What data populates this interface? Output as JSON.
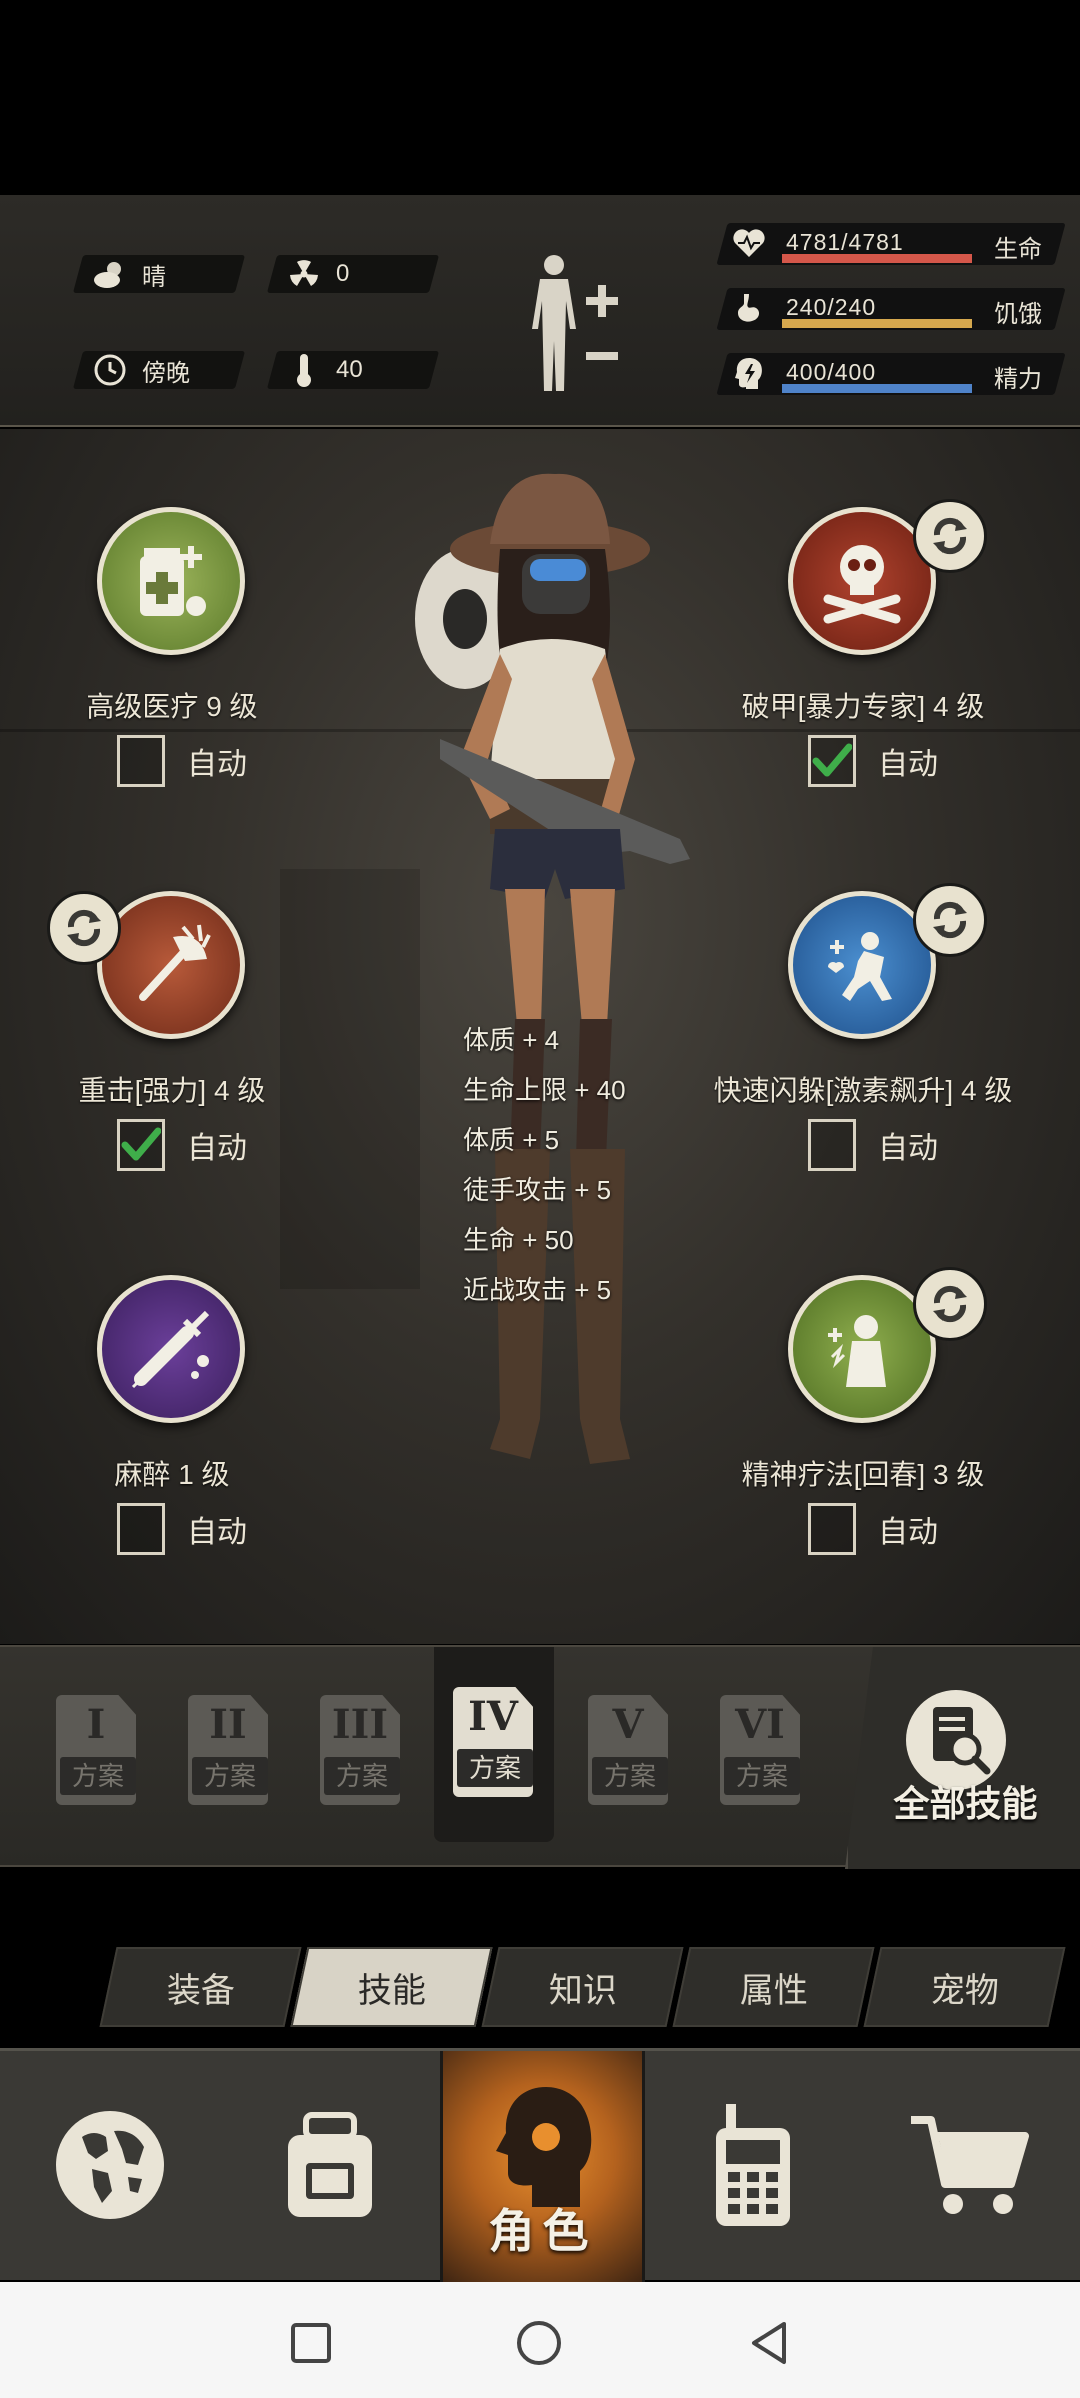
{
  "environment": {
    "weather": "晴",
    "radiation": "0",
    "time_of_day": "傍晚",
    "temperature": "40"
  },
  "vitals": [
    {
      "name": "health",
      "value": "4781/4781",
      "label": "生命",
      "fraction": 1.0,
      "color": "#d5574a"
    },
    {
      "name": "hunger",
      "value": "240/240",
      "label": "饥饿",
      "fraction": 1.0,
      "color": "#d6a84e"
    },
    {
      "name": "energy",
      "value": "400/400",
      "label": "精力",
      "fraction": 1.0,
      "color": "#4f83c9"
    }
  ],
  "skills": [
    {
      "name": "高级医疗 9 级",
      "auto_label": "自动",
      "auto_checked": false,
      "has_variant_badge": false
    },
    {
      "name": "破甲[暴力专家] 4 级",
      "auto_label": "自动",
      "auto_checked": true,
      "has_variant_badge": true
    },
    {
      "name": "重击[强力] 4 级",
      "auto_label": "自动",
      "auto_checked": true,
      "has_variant_badge": true
    },
    {
      "name": "快速闪躲[激素飙升] 4 级",
      "auto_label": "自动",
      "auto_checked": false,
      "has_variant_badge": true
    },
    {
      "name": "麻醉 1 级",
      "auto_label": "自动",
      "auto_checked": false,
      "has_variant_badge": false
    },
    {
      "name": "精神疗法[回春] 3 级",
      "auto_label": "自动",
      "auto_checked": false,
      "has_variant_badge": true
    }
  ],
  "stat_popup": [
    "体质 + 4",
    "生命上限 + 40",
    "体质 + 5",
    "徒手攻击 + 5",
    "生命 + 50",
    "近战攻击 + 5"
  ],
  "plans": [
    {
      "numeral": "I",
      "label": "方案",
      "active": false
    },
    {
      "numeral": "II",
      "label": "方案",
      "active": false
    },
    {
      "numeral": "III",
      "label": "方案",
      "active": false
    },
    {
      "numeral": "IV",
      "label": "方案",
      "active": true
    },
    {
      "numeral": "V",
      "label": "方案",
      "active": false
    },
    {
      "numeral": "VI",
      "label": "方案",
      "active": false
    }
  ],
  "all_skills_label": "全部技能",
  "tabs": [
    {
      "label": "装备",
      "active": false
    },
    {
      "label": "技能",
      "active": true
    },
    {
      "label": "知识",
      "active": false
    },
    {
      "label": "属性",
      "active": false
    },
    {
      "label": "宠物",
      "active": false
    }
  ],
  "bottom_nav": {
    "items": [
      "globe-icon",
      "backpack-icon",
      "character-icon",
      "radio-icon",
      "cart-icon"
    ],
    "active_label": "角色",
    "accent": "#e88f2e"
  }
}
